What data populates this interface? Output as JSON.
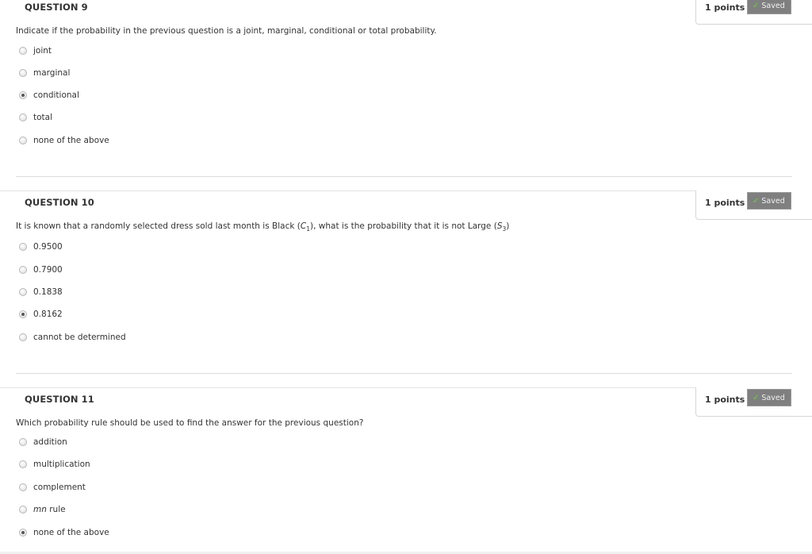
{
  "questions": [
    {
      "title": "QUESTION 9",
      "points": "1 points",
      "saved_label": "Saved",
      "text_parts": [
        "Indicate if the probability in the previous question is a joint, marginal, conditional or total probability."
      ],
      "options": [
        {
          "label": "joint",
          "selected": false
        },
        {
          "label": "marginal",
          "selected": false
        },
        {
          "label": "conditional",
          "selected": true
        },
        {
          "label": "total",
          "selected": false
        },
        {
          "label": "none of the above",
          "selected": false
        }
      ]
    },
    {
      "title": "QUESTION 10",
      "points": "1 points",
      "saved_label": "Saved",
      "text_parts": {
        "a": "It is known that a randomly selected dress sold last month is Black (",
        "c_var": "C",
        "c_sub": "1",
        "b": "), what is the probability that it is not Large (",
        "s_var": "S",
        "s_sub": "3",
        "end": ")"
      },
      "options": [
        {
          "label": "0.9500",
          "selected": false
        },
        {
          "label": "0.7900",
          "selected": false
        },
        {
          "label": "0.1838",
          "selected": false
        },
        {
          "label": "0.8162",
          "selected": true
        },
        {
          "label": "cannot be determined",
          "selected": false
        }
      ]
    },
    {
      "title": "QUESTION 11",
      "points": "1 points",
      "saved_label": "Saved",
      "text_parts": [
        "Which probability rule should be used to find the answer for the previous question?"
      ],
      "options": [
        {
          "label": "addition",
          "selected": false
        },
        {
          "label": "multiplication",
          "selected": false
        },
        {
          "label": "complement",
          "selected": false
        },
        {
          "label": "rule",
          "italic_prefix": "mn",
          "selected": false
        },
        {
          "label": "none of the above",
          "selected": true
        }
      ]
    }
  ],
  "icons": {
    "saved_check": "✓"
  }
}
